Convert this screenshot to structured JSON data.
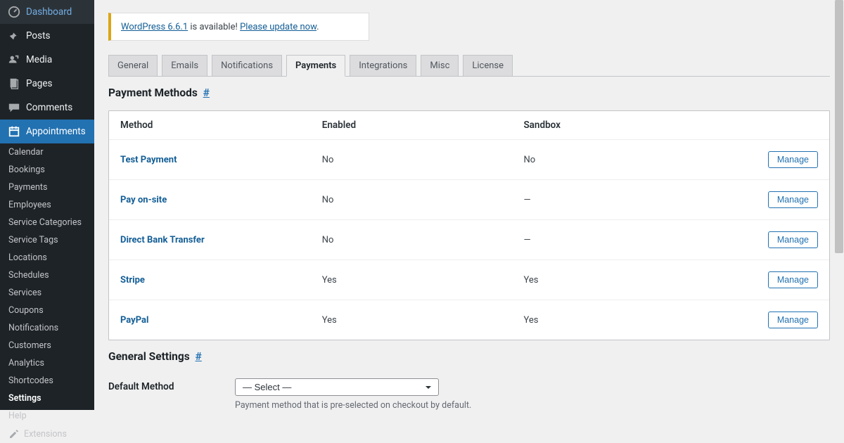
{
  "nav": {
    "dashboard": "Dashboard",
    "posts": "Posts",
    "media": "Media",
    "pages": "Pages",
    "comments": "Comments",
    "appointments": "Appointments"
  },
  "subnav": [
    "Calendar",
    "Bookings",
    "Payments",
    "Employees",
    "Service Categories",
    "Service Tags",
    "Locations",
    "Schedules",
    "Services",
    "Coupons",
    "Notifications",
    "Customers",
    "Analytics",
    "Shortcodes",
    "Settings",
    "Help"
  ],
  "subnav_active_index": 14,
  "extensions_label": "Extensions",
  "notice": {
    "wp_link": "WordPress 6.6.1",
    "available": " is available! ",
    "update_link": "Please update now",
    "period": "."
  },
  "tabs": [
    "General",
    "Emails",
    "Notifications",
    "Payments",
    "Integrations",
    "Misc",
    "License"
  ],
  "active_tab_index": 3,
  "section_payment_methods": "Payment Methods",
  "section_general_settings": "General Settings",
  "anchor_symbol": "#",
  "table": {
    "headers": {
      "method": "Method",
      "enabled": "Enabled",
      "sandbox": "Sandbox"
    },
    "rows": [
      {
        "method": "Test Payment",
        "enabled": "No",
        "sandbox": "No"
      },
      {
        "method": "Pay on-site",
        "enabled": "No",
        "sandbox": "—"
      },
      {
        "method": "Direct Bank Transfer",
        "enabled": "No",
        "sandbox": "—"
      },
      {
        "method": "Stripe",
        "enabled": "Yes",
        "sandbox": "Yes"
      },
      {
        "method": "PayPal",
        "enabled": "Yes",
        "sandbox": "Yes"
      }
    ],
    "manage_label": "Manage"
  },
  "settings": {
    "default_method_label": "Default Method",
    "default_method_value": "— Select —",
    "default_method_desc": "Payment method that is pre-selected on checkout by default."
  }
}
